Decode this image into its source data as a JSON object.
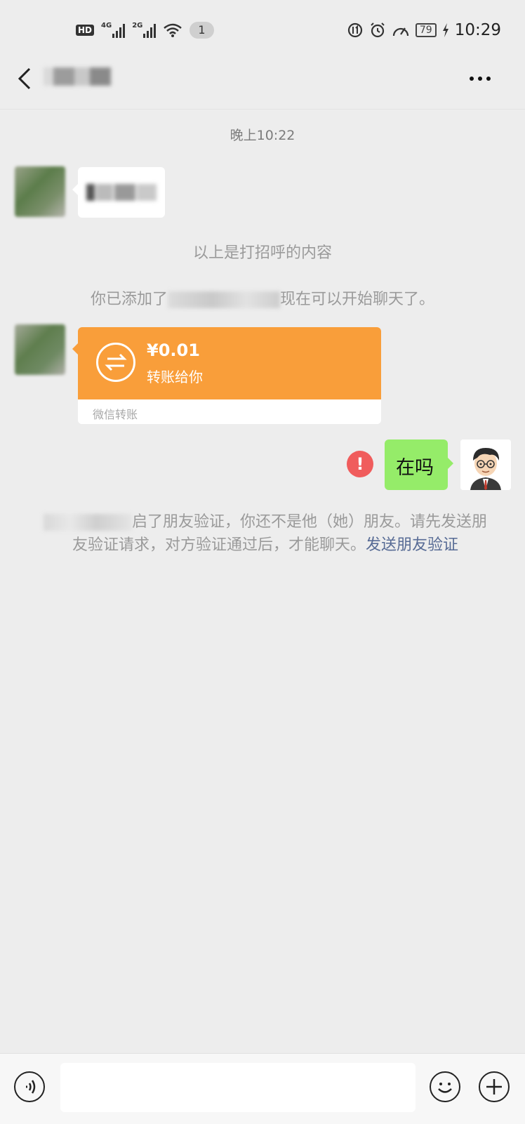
{
  "status_bar": {
    "hd": "HD",
    "net_1": "4G",
    "net_2": "2G",
    "notification_count": "1",
    "battery": "79",
    "time": "10:29"
  },
  "chat": {
    "time_label": "晚上10:22",
    "greeting_note": "以上是打招呼的内容",
    "added_prefix": "你已添加了",
    "added_suffix": "现在可以开始聊天了。",
    "transfer": {
      "amount": "¥0.01",
      "desc": "转账给你",
      "source": "微信转账"
    },
    "my_message": "在吗",
    "notice_text": "启了朋友验证，你还不是他（她）朋友。请先发送朋友验证请求，对方验证通过后，才能聊天。",
    "notice_link": "发送朋友验证"
  }
}
